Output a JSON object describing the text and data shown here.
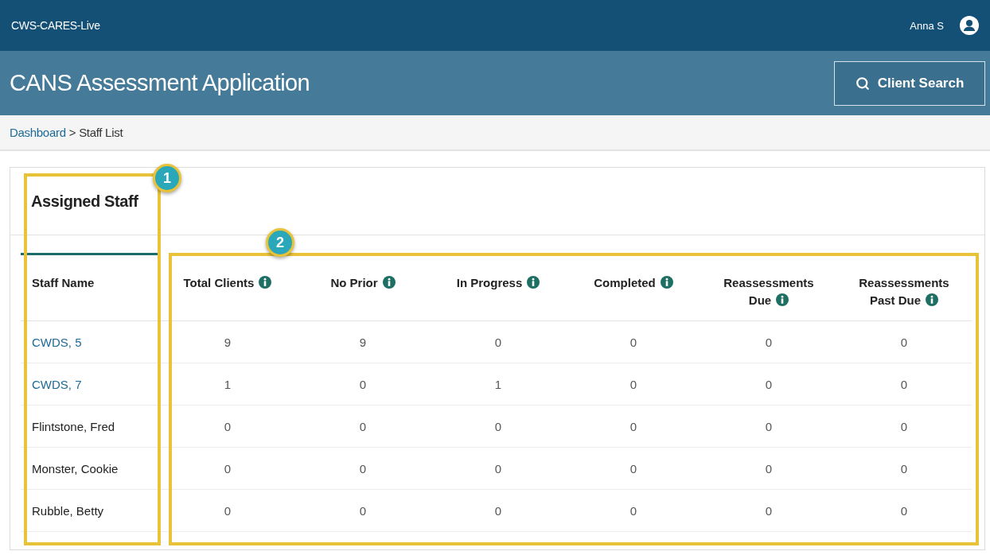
{
  "top_bar": {
    "app_name": "CWS-CARES-Live",
    "user_name": "Anna S"
  },
  "header": {
    "title": "CANS Assessment Application",
    "search_button": "Client Search"
  },
  "breadcrumb": {
    "link": "Dashboard",
    "separator": ">",
    "current": "Staff List"
  },
  "card": {
    "title": "Assigned Staff"
  },
  "table": {
    "columns": [
      {
        "label": "Staff Name",
        "info": false
      },
      {
        "label": "Total Clients",
        "info": true
      },
      {
        "label": "No Prior",
        "info": true
      },
      {
        "label": "In Progress",
        "info": true
      },
      {
        "label": "Completed",
        "info": true
      },
      {
        "label": "Reassessments Due",
        "info": true
      },
      {
        "label": "Reassessments Past Due",
        "info": true
      }
    ],
    "rows": [
      {
        "name": "CWDS, 5",
        "link": true,
        "values": [
          "9",
          "9",
          "0",
          "0",
          "0",
          "0"
        ]
      },
      {
        "name": "CWDS, 7",
        "link": true,
        "values": [
          "1",
          "0",
          "1",
          "0",
          "0",
          "0"
        ]
      },
      {
        "name": "Flintstone, Fred",
        "link": false,
        "values": [
          "0",
          "0",
          "0",
          "0",
          "0",
          "0"
        ]
      },
      {
        "name": "Monster, Cookie",
        "link": false,
        "values": [
          "0",
          "0",
          "0",
          "0",
          "0",
          "0"
        ]
      },
      {
        "name": "Rubble, Betty",
        "link": false,
        "values": [
          "0",
          "0",
          "0",
          "0",
          "0",
          "0"
        ]
      }
    ]
  },
  "callouts": [
    {
      "number": "1"
    },
    {
      "number": "2"
    }
  ]
}
